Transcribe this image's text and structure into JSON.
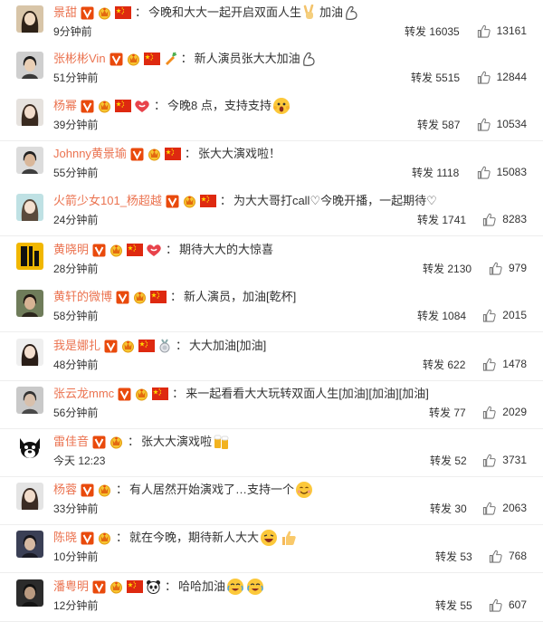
{
  "labels": {
    "repost": "转发"
  },
  "colors": {
    "name": "#eb7350",
    "vip_badge": "#e94a0c",
    "gold_badge": "#f2b320",
    "flag": "#de2910",
    "heart_badge": "#e8434b"
  },
  "comments": [
    {
      "avatar": "avatar-jingtian",
      "name": "景甜",
      "badges": [
        "vip-v-icon",
        "gold-crown-icon",
        "china-flag-icon"
      ],
      "text": "今晚和大大一起开启双面人生",
      "text_icons": [
        "victory-hand-emoji"
      ],
      "text2": "加油",
      "end_icons": [
        "flexed-arm-emoji"
      ],
      "time": "9分钟前",
      "reposts": "16035",
      "likes": "13161"
    },
    {
      "avatar": "avatar-zhangbinbin",
      "name": "张彬彬Vin",
      "badges": [
        "vip-v-icon",
        "gold-crown-icon",
        "china-flag-icon",
        "carrot-badge-icon"
      ],
      "text": "新人演员张大大加油",
      "end_icons": [
        "flexed-arm-emoji"
      ],
      "time": "51分钟前",
      "reposts": "5515",
      "likes": "12844"
    },
    {
      "avatar": "avatar-yangmi",
      "name": "杨幂",
      "badges": [
        "vip-v-icon",
        "gold-crown-icon",
        "china-flag-icon",
        "heart-badge-icon"
      ],
      "text": "今晚8 点，支持支持",
      "end_icons": [
        "shocked-face-emoji"
      ],
      "time": "39分钟前",
      "reposts": "587",
      "likes": "10534"
    },
    {
      "avatar": "avatar-huangjingyu",
      "name": "Johnny黄景瑜",
      "badges": [
        "vip-v-icon",
        "gold-crown-icon",
        "china-flag-icon"
      ],
      "text": "张大大演戏啦！",
      "time": "55分钟前",
      "reposts": "1118",
      "likes": "15083"
    },
    {
      "avatar": "avatar-yangchaoyue",
      "name": "火箭少女101_杨超越",
      "badges": [
        "vip-v-icon",
        "gold-crown-icon",
        "china-flag-icon"
      ],
      "text": "为大大哥打call♡今晚开播，一起期待♡",
      "time": "24分钟前",
      "reposts": "1741",
      "likes": "8283"
    },
    {
      "avatar": "avatar-huangxiaoming",
      "name": "黄晓明",
      "badges": [
        "vip-v-icon",
        "gold-crown-icon",
        "china-flag-icon",
        "heart-badge-icon"
      ],
      "text": "期待大大的大惊喜",
      "time": "28分钟前",
      "reposts": "2130",
      "likes": "979"
    },
    {
      "avatar": "avatar-huangxuan",
      "name": "黄轩的微博",
      "badges": [
        "vip-v-icon",
        "gold-crown-icon",
        "china-flag-icon"
      ],
      "text": "新人演员，加油[乾杯]",
      "time": "58分钟前",
      "reposts": "1084",
      "likes": "2015"
    },
    {
      "avatar": "avatar-nazha",
      "name": "我是娜扎",
      "badges": [
        "vip-v-icon",
        "gold-crown-icon",
        "china-flag-icon",
        "medal-badge-icon"
      ],
      "text": "大大加油[加油]",
      "time": "48分钟前",
      "reposts": "622",
      "likes": "1478"
    },
    {
      "avatar": "avatar-zhangyunlong",
      "name": "张云龙mmc",
      "badges": [
        "vip-v-icon",
        "gold-crown-icon",
        "china-flag-icon"
      ],
      "text": "来一起看看大大玩转双面人生[加油][加油][加油]",
      "time": "56分钟前",
      "reposts": "77",
      "likes": "2029"
    },
    {
      "avatar": "avatar-leijiayin",
      "name": "雷佳音",
      "badges": [
        "vip-v-icon",
        "gold-crown-icon"
      ],
      "text": "张大大演戏啦",
      "end_icons": [
        "beer-mugs-emoji"
      ],
      "time": "今天 12:23",
      "reposts": "52",
      "likes": "3731"
    },
    {
      "avatar": "avatar-yangrong",
      "name": "杨蓉",
      "badges": [
        "vip-v-icon",
        "gold-crown-icon"
      ],
      "text": "有人居然开始演戏了…支持一个",
      "end_icons": [
        "smile-face-emoji"
      ],
      "time": "33分钟前",
      "reposts": "30",
      "likes": "2063"
    },
    {
      "avatar": "avatar-chenxiao",
      "name": "陈晓",
      "badges": [
        "vip-v-icon",
        "gold-crown-icon"
      ],
      "text": "就在今晚，期待新人大大",
      "end_icons": [
        "laughing-face-emoji",
        "thumbs-up-emoji"
      ],
      "time": "10分钟前",
      "reposts": "53",
      "likes": "768"
    },
    {
      "avatar": "avatar-panyueming",
      "name": "潘粤明",
      "badges": [
        "vip-v-icon",
        "gold-crown-icon",
        "china-flag-icon",
        "panda-badge-icon"
      ],
      "text": "哈哈加油",
      "end_icons": [
        "tearful-laugh-emoji",
        "tearful-laugh-emoji"
      ],
      "time": "12分钟前",
      "reposts": "55",
      "likes": "607"
    }
  ]
}
